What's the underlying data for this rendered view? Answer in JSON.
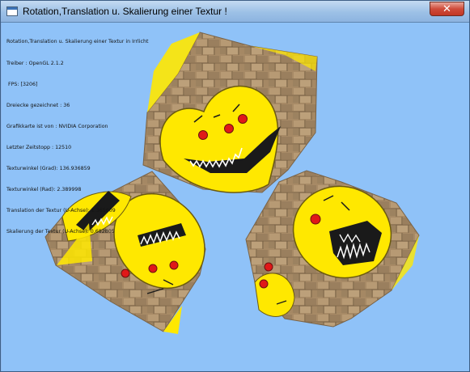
{
  "window": {
    "title": "Rotation,Translation u. Skalierung einer Textur !",
    "close_glyph": "✕"
  },
  "overlay": {
    "lines": [
      "Rotation,Translation u. Skalierung einer Textur in Irrlicht",
      "Treiber : OpenGL 2.1.2",
      " FPS: [3206]",
      "Dreiecke gezeichnet : 36",
      "Grafikkarte ist von : NVIDIA Corporation",
      "Letzter Zeitstopp : 12510",
      "Texturwinkel (Grad): 136.936859",
      "Texturwinkel (Rad): 2.389998",
      "Translation der Textur (U-Achse): 1.365609",
      "Skalierung der Textur (U-Achse): 0.682805"
    ]
  },
  "scene": {
    "background": "#8fc2f8",
    "objects": [
      "textured-cube-top",
      "textured-cube-left",
      "textured-cube-right"
    ],
    "texture": {
      "stone_color": "#a78a66",
      "smiley_color": "#ffe800",
      "eye_color": "#e01818",
      "outline_color": "#1a1a1a"
    }
  }
}
